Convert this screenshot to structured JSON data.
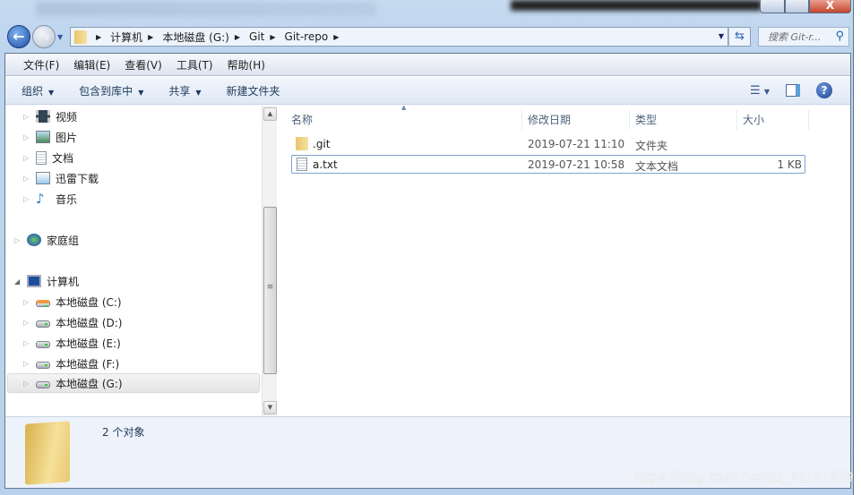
{
  "window": {
    "controls": {
      "minimize": "–",
      "maximize": "□",
      "close": "X"
    }
  },
  "address": {
    "crumbs": [
      "计算机",
      "本地磁盘 (G:)",
      "Git",
      "Git-repo"
    ],
    "search_placeholder": "搜索 Git-r..."
  },
  "menu": [
    "文件(F)",
    "编辑(E)",
    "查看(V)",
    "工具(T)",
    "帮助(H)"
  ],
  "toolbar": {
    "organize": "组织",
    "include_library": "包含到库中",
    "share": "共享",
    "new_folder": "新建文件夹"
  },
  "nav": {
    "libraries": [
      "视频",
      "图片",
      "文档",
      "迅雷下载",
      "音乐"
    ],
    "homegroup": "家庭组",
    "computer": "计算机",
    "drives": [
      "本地磁盘 (C:)",
      "本地磁盘 (D:)",
      "本地磁盘 (E:)",
      "本地磁盘 (F:)",
      "本地磁盘 (G:)"
    ],
    "selected": "本地磁盘 (G:)"
  },
  "columns": {
    "name": "名称",
    "modified": "修改日期",
    "type": "类型",
    "size": "大小"
  },
  "files": [
    {
      "name": ".git",
      "modified": "2019-07-21 11:10",
      "type": "文件夹",
      "size": "",
      "icon": "folder-icon"
    },
    {
      "name": "a.txt",
      "modified": "2019-07-21 10:58",
      "type": "文本文档",
      "size": "1 KB",
      "icon": "text-file-icon"
    }
  ],
  "details": {
    "count": "2 个对象"
  },
  "watermark": "https://blog.csdn.net/qq_41151659"
}
